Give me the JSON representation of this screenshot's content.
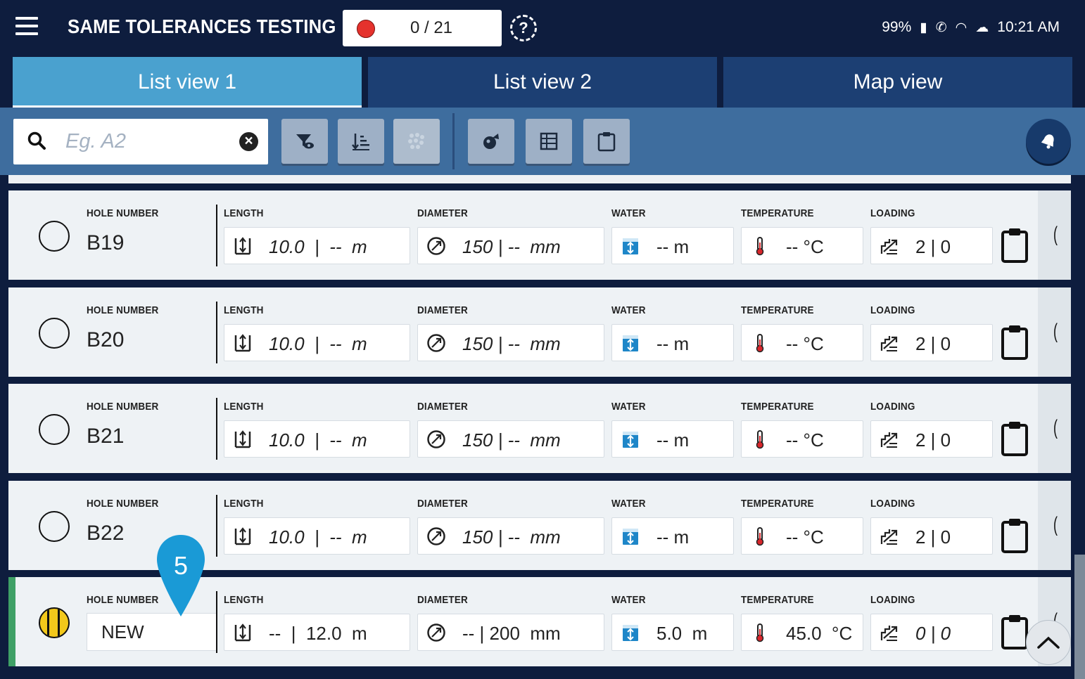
{
  "header": {
    "title": "SAME TOLERANCES TESTING",
    "progress": "0 / 21",
    "status": {
      "battery": "99%",
      "time": "10:21 AM"
    }
  },
  "tabs": [
    {
      "label": "List view 1",
      "active": true
    },
    {
      "label": "List view 2",
      "active": false
    },
    {
      "label": "Map view",
      "active": false
    }
  ],
  "search": {
    "placeholder": "Eg. A2",
    "value": ""
  },
  "toolbar": {
    "buttons": [
      "filter-eye-icon",
      "sort-icon",
      "dots-pattern-icon",
      "tag-icon",
      "grid-table-icon",
      "clipboard-icon"
    ],
    "fab_icon": "notification-bell-icon"
  },
  "labels": {
    "hole": "HOLE NUMBER",
    "length": "LENGTH",
    "diameter": "DIAMETER",
    "water": "WATER",
    "temperature": "TEMPERATURE",
    "loading": "LOADING"
  },
  "rows": [
    {
      "hole": "B19",
      "length": "10.0  |  --  m",
      "diameter": "150 | --  mm",
      "water": "-- m",
      "temperature": "-- °C",
      "loading": "2 | 0"
    },
    {
      "hole": "B20",
      "length": "10.0  |  --  m",
      "diameter": "150 | --  mm",
      "water": "-- m",
      "temperature": "-- °C",
      "loading": "2 | 0"
    },
    {
      "hole": "B21",
      "length": "10.0  |  --  m",
      "diameter": "150 | --  mm",
      "water": "-- m",
      "temperature": "-- °C",
      "loading": "2 | 0"
    },
    {
      "hole": "B22",
      "length": "10.0  |  --  m",
      "diameter": "150 | --  mm",
      "water": "-- m",
      "temperature": "-- °C",
      "loading": "2 | 0"
    },
    {
      "hole": "NEW",
      "length": "--  |  12.0  m",
      "diameter": "-- | 200  mm",
      "water": "5.0  m",
      "temperature": "45.0  °C",
      "loading": "0 | 0",
      "is_new": true
    }
  ],
  "callout": {
    "number": "5",
    "color": "#1a9ad6"
  },
  "colors": {
    "active_tab": "#4aa1cf",
    "inactive_tab": "#1c3f73",
    "new_row_marker": "#3fa066",
    "record": "#e5322d"
  }
}
